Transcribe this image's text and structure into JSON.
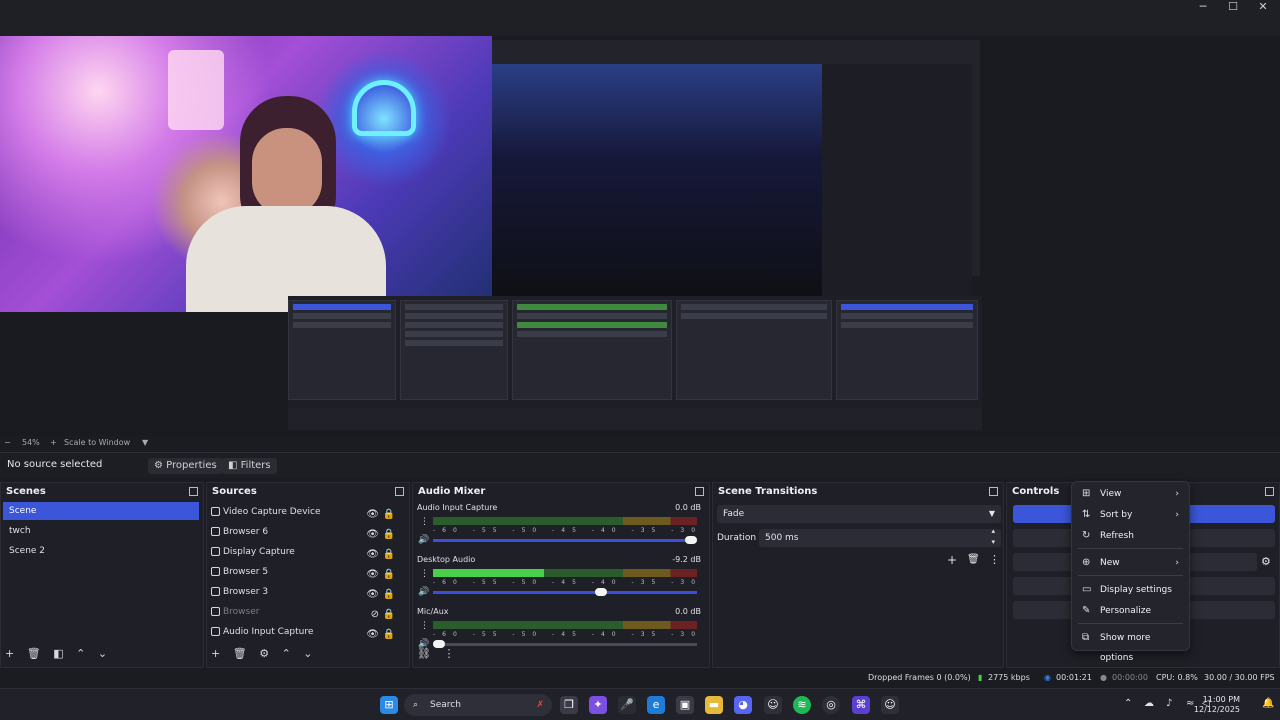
{
  "window": {
    "minimize": "─",
    "maximize": "☐",
    "close": "✕"
  },
  "preview": {
    "zoom": "54%",
    "scale_mode": "Scale to Window"
  },
  "source_bar": {
    "status": "No source selected",
    "properties": "Properties",
    "filters": "Filters"
  },
  "scenes": {
    "title": "Scenes",
    "items": [
      "Scene",
      "twch",
      "Scene 2"
    ],
    "selected": 0
  },
  "sources": {
    "title": "Sources",
    "items": [
      {
        "label": "Video Capture Device",
        "icon": "camera-icon",
        "visible": true
      },
      {
        "label": "Browser 6",
        "icon": "globe-icon",
        "visible": true
      },
      {
        "label": "Display Capture",
        "icon": "monitor-icon",
        "visible": true
      },
      {
        "label": "Browser 5",
        "icon": "globe-icon",
        "visible": true
      },
      {
        "label": "Browser 3",
        "icon": "globe-icon",
        "visible": true
      },
      {
        "label": "Browser",
        "icon": "globe-icon",
        "visible": false
      },
      {
        "label": "Audio Input Capture",
        "icon": "mic-icon",
        "visible": true
      }
    ]
  },
  "audio_mixer": {
    "title": "Audio Mixer",
    "channels": [
      {
        "name": "Audio Input Capture",
        "db": "0.0 dB",
        "level": 0.0,
        "volume": 1.0
      },
      {
        "name": "Desktop Audio",
        "db": "-9.2 dB",
        "level": 0.42,
        "volume": 0.66
      },
      {
        "name": "Mic/Aux",
        "db": "0.0 dB",
        "level": 0.0,
        "volume": 0.0
      }
    ],
    "scale": "-60 -55 -50 -45 -40 -35 -30 -25 -20 -15 -10 -5 0"
  },
  "scene_transitions": {
    "title": "Scene Transitions",
    "transition": "Fade",
    "duration_label": "Duration",
    "duration_value": "500 ms"
  },
  "controls": {
    "title": "Controls"
  },
  "context_menu": {
    "items": [
      "View",
      "Sort by",
      "Refresh",
      "New",
      "Display settings",
      "Personalize",
      "Show more options"
    ]
  },
  "statusbar": {
    "dropped": "Dropped Frames 0 (0.0%)",
    "bitrate": "2775 kbps",
    "stream_time": "00:01:21",
    "rec_time": "00:00:00",
    "cpu": "CPU: 0.8%",
    "fps": "30.00 / 30.00 FPS"
  },
  "taskbar": {
    "search": "Search",
    "time": "11:00 PM",
    "date": "12/12/2025"
  },
  "colors": {
    "accent": "#3b56d9",
    "panel": "#1f2027",
    "meter_green": "#48d04a"
  }
}
